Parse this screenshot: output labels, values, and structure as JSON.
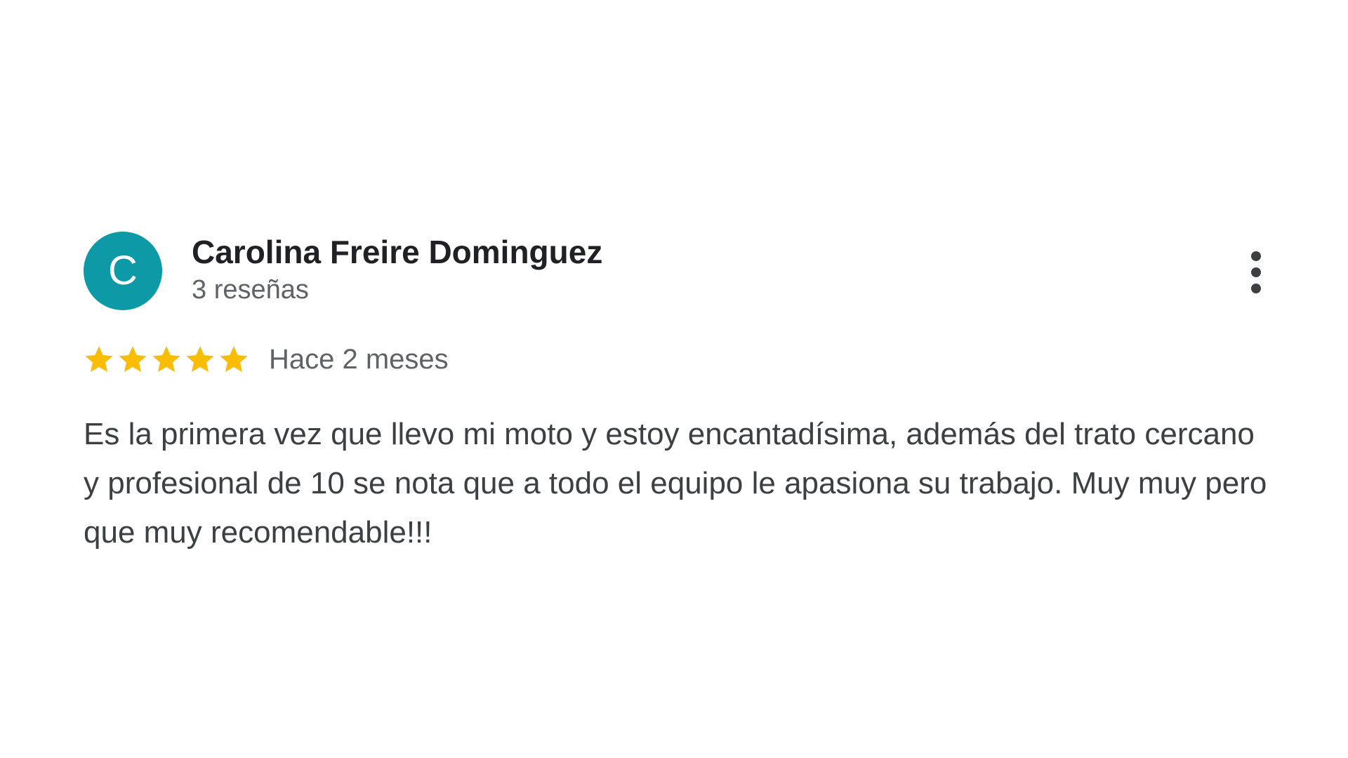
{
  "review": {
    "author": {
      "initial": "C",
      "name": "Carolina Freire Dominguez",
      "review_count": "3 reseñas",
      "avatar_color": "#0d9aa6"
    },
    "rating": {
      "value": 5,
      "max": 5,
      "star_color": "#fbbc04"
    },
    "time_ago": "Hace 2 meses",
    "text": "Es la primera vez que llevo mi moto y estoy encantadísima, además del trato cercano y profesional de 10 se nota que a todo el equipo le apasiona su trabajo. Muy muy pero que muy recomendable!!!",
    "menu_icon": "more-vert-icon"
  }
}
